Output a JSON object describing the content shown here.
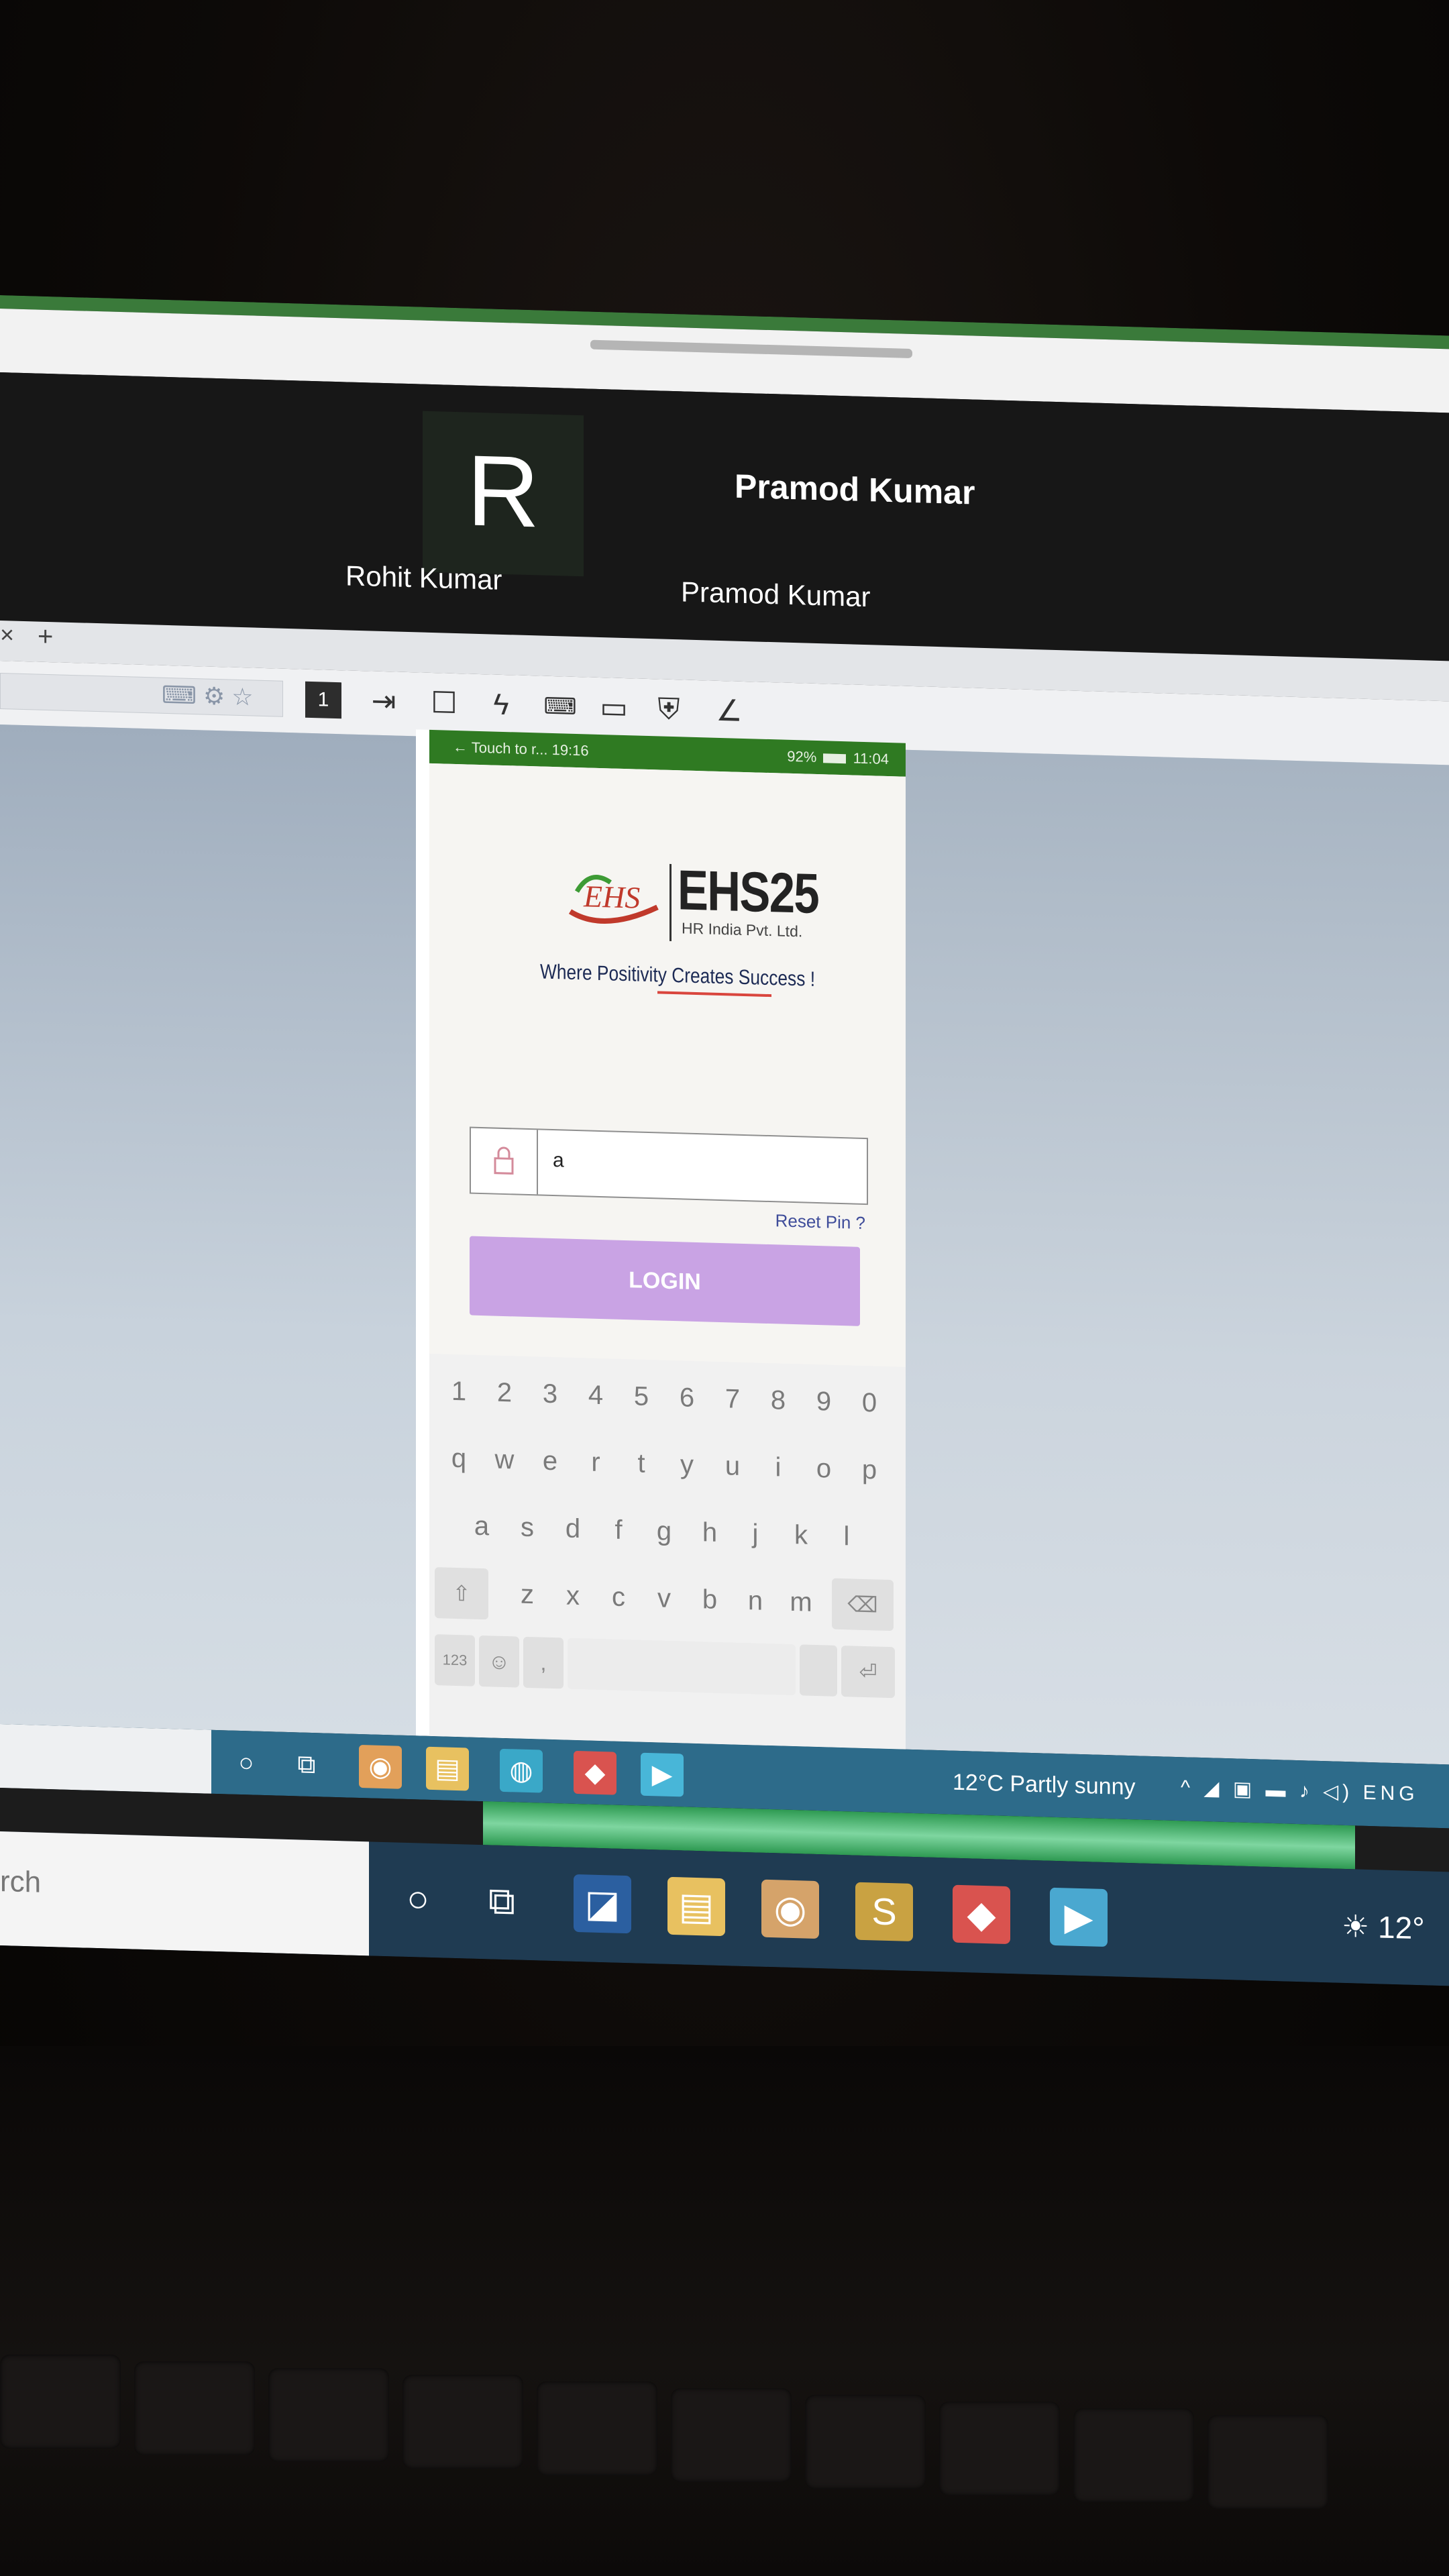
{
  "video": {
    "tile1_letter": "R",
    "tile1_name": "Rohit Kumar",
    "tile2_bold_name": "Pramod Kumar",
    "tile2_name": "Pramod Kumar"
  },
  "browser": {
    "tab_close": "×",
    "tab_new": "+"
  },
  "remote_toolbar": {
    "monitor_number": "1"
  },
  "phone": {
    "status_back": "←",
    "status_app": "Touch to r...",
    "status_time_left": "19:16",
    "status_battery": "92%",
    "status_time_right": "11:04",
    "brand": "EHS25",
    "brand_sub": "HR India Pvt. Ltd.",
    "logo_mark_text": "EHS",
    "tagline": "Where Positivity Creates Success !",
    "pin_value": "a",
    "reset_pin": "Reset Pin ?",
    "login_label": "LOGIN",
    "keyboard": {
      "row_numbers": [
        "1",
        "2",
        "3",
        "4",
        "5",
        "6",
        "7",
        "8",
        "9",
        "0"
      ],
      "row_top": [
        "q",
        "w",
        "e",
        "r",
        "t",
        "y",
        "u",
        "i",
        "o",
        "p"
      ],
      "row_mid": [
        "a",
        "s",
        "d",
        "f",
        "g",
        "h",
        "j",
        "k",
        "l"
      ],
      "row_bottom": [
        "z",
        "x",
        "c",
        "v",
        "b",
        "n",
        "m"
      ],
      "key_123": "123",
      "key_comma": ","
    }
  },
  "remote_taskbar": {
    "weather": "12°C  Partly sunny",
    "language": "ENG"
  },
  "local_taskbar": {
    "search_placeholder": "rch",
    "weather_temp": "12°"
  },
  "colors": {
    "phone_status_green": "#2f7a22",
    "login_button": "#c9a3e4",
    "tagline_underline": "#d9453d",
    "taskbar_blue": "#2d6b8a"
  }
}
